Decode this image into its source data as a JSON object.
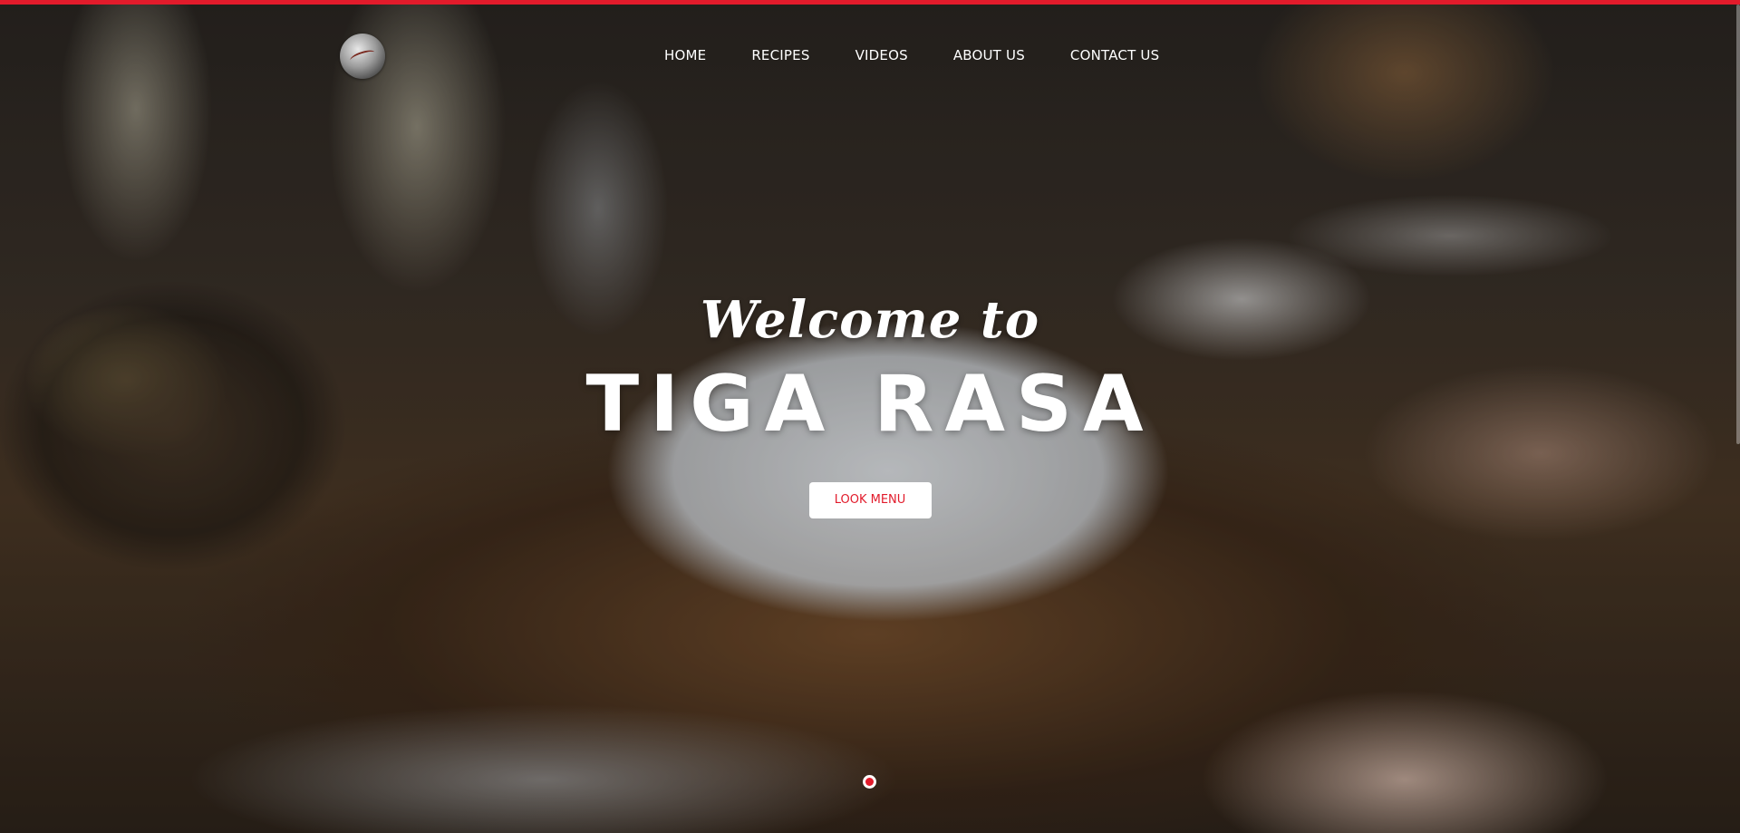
{
  "theme": {
    "accent_color": "#e21b2b",
    "text_color": "#ffffff"
  },
  "header": {
    "logo_icon": "silver-globe-logo",
    "nav": [
      {
        "label": "HOME"
      },
      {
        "label": "RECIPES"
      },
      {
        "label": "VIDEOS"
      },
      {
        "label": "ABOUT US"
      },
      {
        "label": "CONTACT US"
      }
    ]
  },
  "hero": {
    "welcome": "Welcome to",
    "title": "TIGA RASA",
    "button_label": "LOOK MENU"
  },
  "slider": {
    "active_slide": 1,
    "total_slides": 1
  }
}
